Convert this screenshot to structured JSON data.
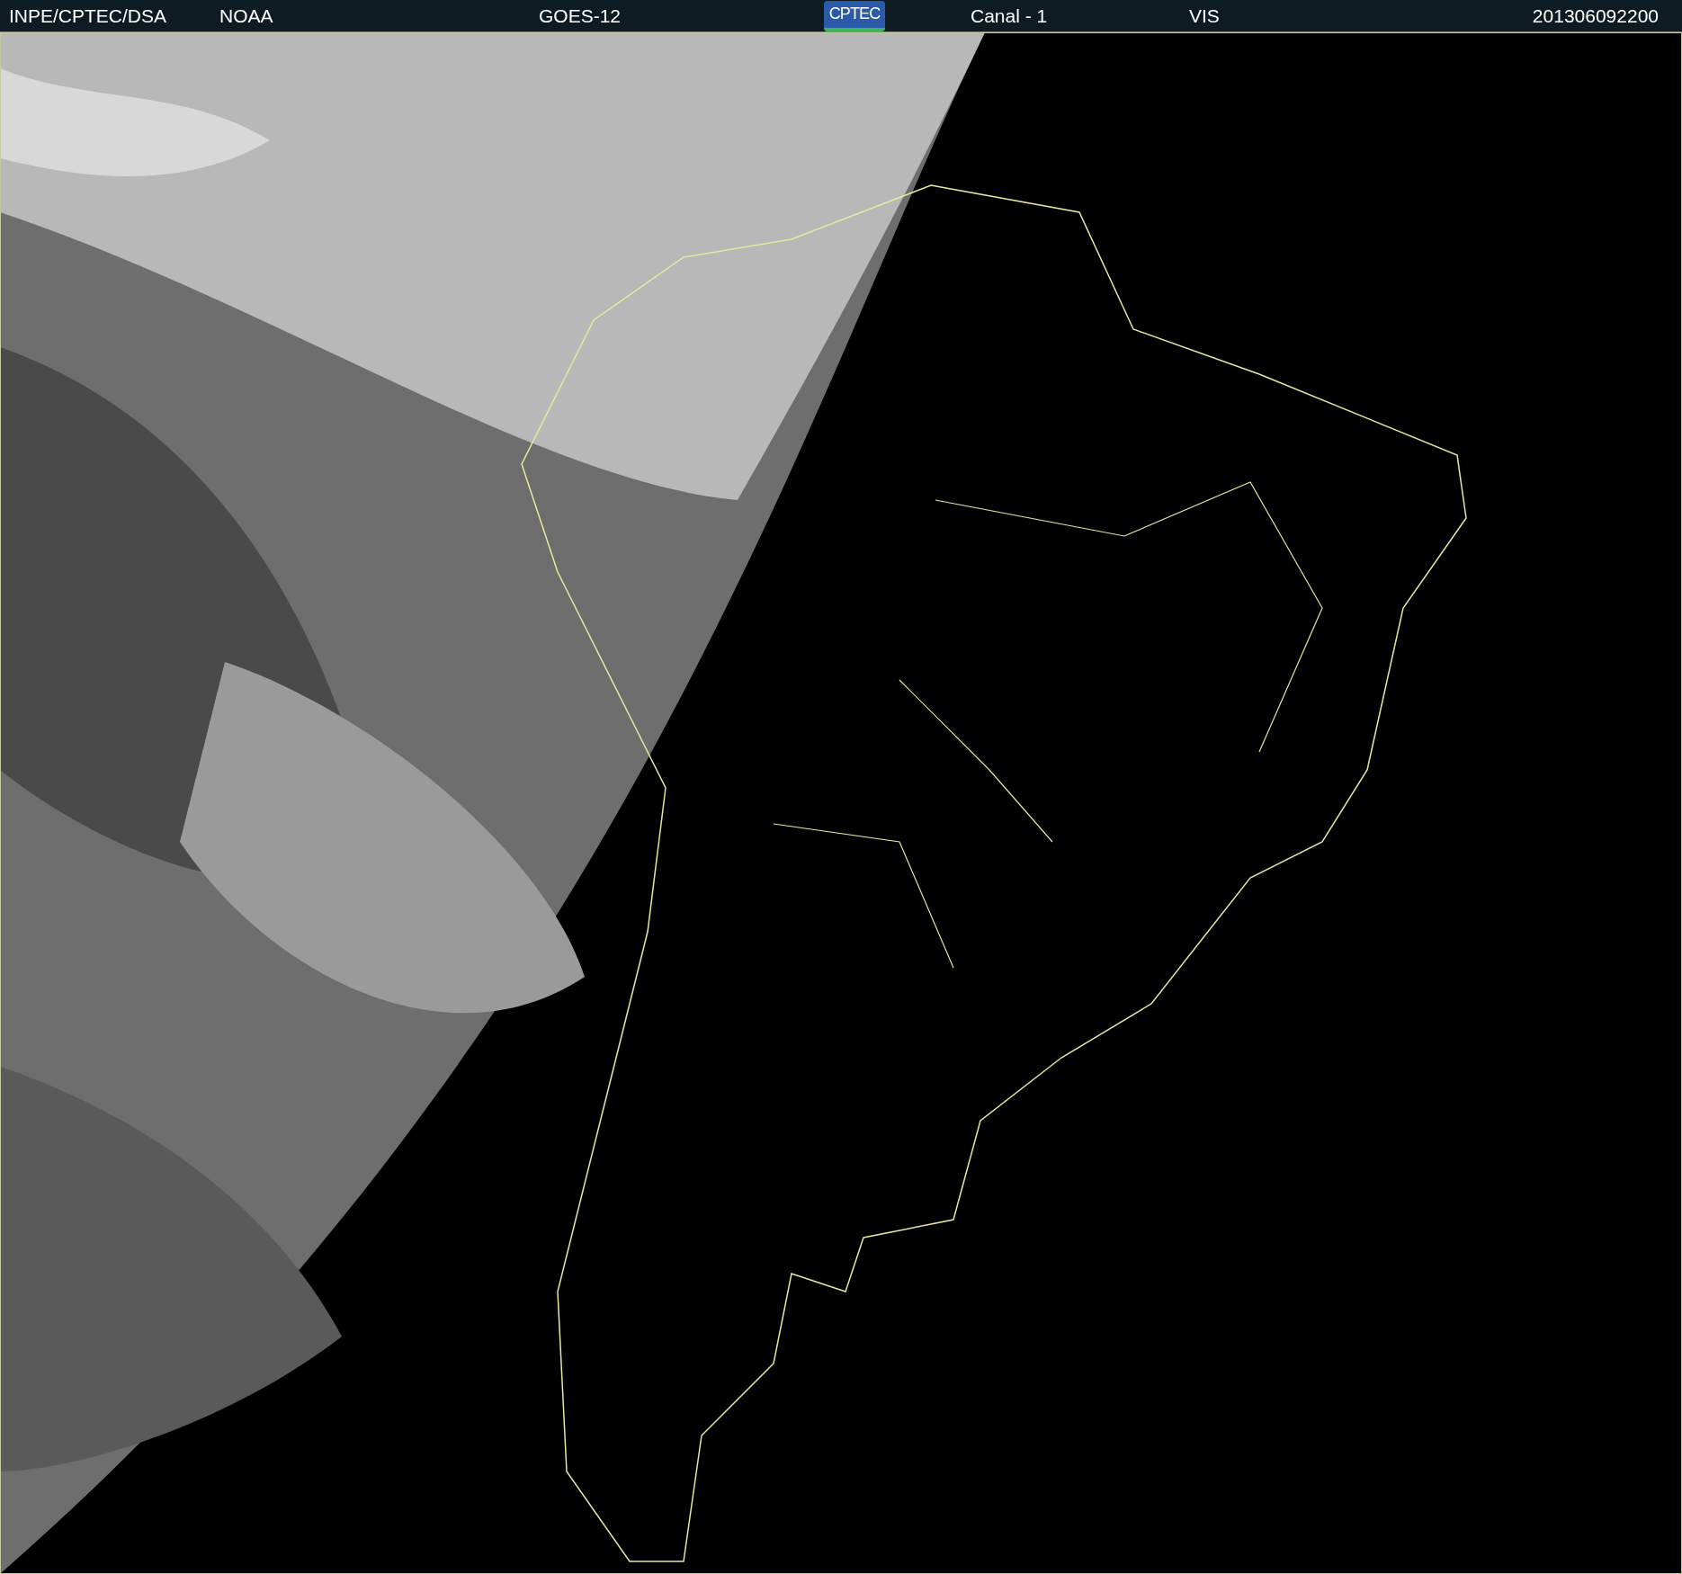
{
  "header": {
    "source": "INPE/CPTEC/DSA",
    "agency": "NOAA",
    "satellite": "GOES-12",
    "logo": "CPTEC",
    "channel": "Canal - 1",
    "band": "VIS",
    "timestamp": "201306092200"
  }
}
